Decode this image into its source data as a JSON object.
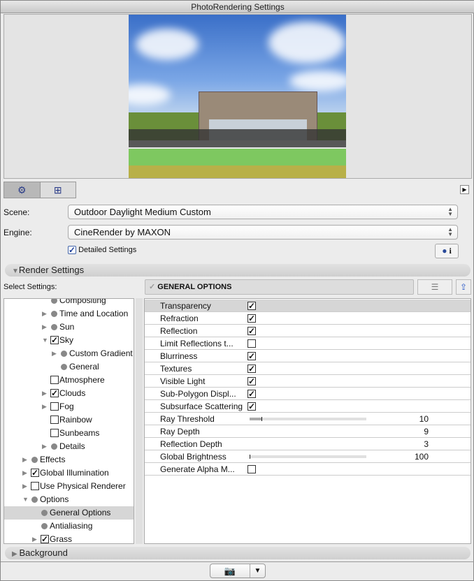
{
  "window_title": "PhotoRendering Settings",
  "scene": {
    "label": "Scene:",
    "value": "Outdoor Daylight Medium Custom"
  },
  "engine": {
    "label": "Engine:",
    "value": "CineRender by MAXON"
  },
  "detailed_settings": {
    "label": "Detailed Settings",
    "checked": true
  },
  "render_settings_label": "Render Settings",
  "select_settings_label": "Select Settings:",
  "current_group": "GENERAL OPTIONS",
  "background_label": "Background",
  "tree": [
    {
      "label": "Compositing",
      "level": 2,
      "arrow": "none",
      "marker": "dot"
    },
    {
      "label": "Time and Location",
      "level": 2,
      "arrow": "right",
      "marker": "dot"
    },
    {
      "label": "Sun",
      "level": 2,
      "arrow": "right",
      "marker": "dot"
    },
    {
      "label": "Sky",
      "level": 2,
      "arrow": "down",
      "marker": "checked"
    },
    {
      "label": "Custom Gradient",
      "level": 3,
      "arrow": "right",
      "marker": "dot"
    },
    {
      "label": "General",
      "level": 3,
      "arrow": "none",
      "marker": "dot"
    },
    {
      "label": "Atmosphere",
      "level": 2,
      "arrow": "none",
      "marker": "unchecked"
    },
    {
      "label": "Clouds",
      "level": 2,
      "arrow": "right",
      "marker": "checked"
    },
    {
      "label": "Fog",
      "level": 2,
      "arrow": "right",
      "marker": "unchecked"
    },
    {
      "label": "Rainbow",
      "level": 2,
      "arrow": "none",
      "marker": "unchecked"
    },
    {
      "label": "Sunbeams",
      "level": 2,
      "arrow": "none",
      "marker": "unchecked"
    },
    {
      "label": "Details",
      "level": 2,
      "arrow": "right",
      "marker": "dot"
    },
    {
      "label": "Effects",
      "level": 0,
      "arrow": "right",
      "marker": "dot"
    },
    {
      "label": "Global Illumination",
      "level": 0,
      "arrow": "right",
      "marker": "checked"
    },
    {
      "label": "Use Physical Renderer",
      "level": 0,
      "arrow": "right",
      "marker": "unchecked"
    },
    {
      "label": "Options",
      "level": 0,
      "arrow": "down",
      "marker": "dot"
    },
    {
      "label": "General Options",
      "level": 1,
      "arrow": "none",
      "marker": "dot",
      "selected": true
    },
    {
      "label": "Antialiasing",
      "level": 1,
      "arrow": "none",
      "marker": "dot"
    },
    {
      "label": "Grass",
      "level": 1,
      "arrow": "right",
      "marker": "checked"
    }
  ],
  "options": [
    {
      "name": "Transparency",
      "type": "check",
      "checked": true,
      "selected": true
    },
    {
      "name": "Refraction",
      "type": "check",
      "checked": true
    },
    {
      "name": "Reflection",
      "type": "check",
      "checked": true
    },
    {
      "name": "Limit Reflections t...",
      "type": "check",
      "checked": false
    },
    {
      "name": "Blurriness",
      "type": "check",
      "checked": true
    },
    {
      "name": "Textures",
      "type": "check",
      "checked": true
    },
    {
      "name": "Visible Light",
      "type": "check",
      "checked": true
    },
    {
      "name": "Sub-Polygon Displ...",
      "type": "check",
      "checked": true
    },
    {
      "name": "Subsurface Scattering",
      "type": "check",
      "checked": true
    },
    {
      "name": "Ray Threshold",
      "type": "slider",
      "value": "10",
      "fraction": 0.1
    },
    {
      "name": "Ray Depth",
      "type": "value",
      "value": "9"
    },
    {
      "name": "Reflection Depth",
      "type": "value",
      "value": "3"
    },
    {
      "name": "Global Brightness",
      "type": "slider",
      "value": "100",
      "fraction": 0.0
    },
    {
      "name": "Generate Alpha M...",
      "type": "check",
      "checked": false
    }
  ]
}
